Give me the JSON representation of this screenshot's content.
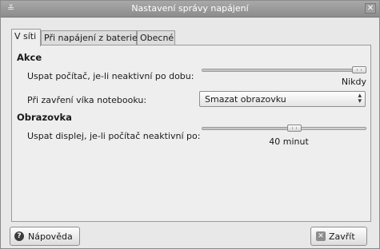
{
  "window": {
    "title": "Nastavení správy napájení"
  },
  "tabs": [
    {
      "label": "V síti",
      "active": true
    },
    {
      "label": "Při napájení z baterie",
      "active": false
    },
    {
      "label": "Obecné",
      "active": false
    }
  ],
  "akce": {
    "title": "Akce",
    "sleep_label": "Uspat počítač, je-li neaktivní po dobu:",
    "sleep_value": "Nikdy",
    "sleep_level": 1.0,
    "lid_label": "Při zavření víka notebooku:",
    "lid_selected": "Smazat obrazovku"
  },
  "obrazovka": {
    "title": "Obrazovka",
    "display_label": "Uspat displej, je-li počítač neaktivní po:",
    "display_value": "40 minut",
    "display_level": 0.57
  },
  "buttons": {
    "help": "Nápověda",
    "close": "Zavřít"
  },
  "icons": {
    "help": "help-icon",
    "close": "close-icon"
  }
}
